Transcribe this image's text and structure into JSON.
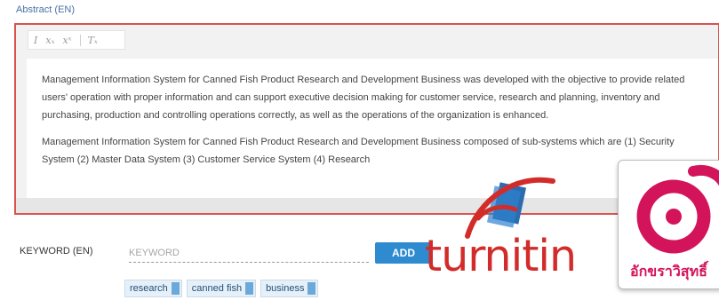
{
  "abstract": {
    "label": "Abstract (EN)",
    "toolbar": {
      "italic_label": "I",
      "subscript_label": "xₓ",
      "superscript_label": "xˣ",
      "clear_format_label": "Tₓ"
    },
    "paragraph_1": "Management Information System for Canned Fish Product Research and Development Business was developed with the objective to provide related users' operation with proper information and can support executive decision making for customer service, research and planning, inventory and purchasing, production and controlling operations correctly, as well as the operations of the organization is enhanced.",
    "paragraph_2": "Management Information System for Canned Fish Product Research and Development Business composed of sub-systems which are (1) Security System (2) Master Data System (3) Customer Service System (4) Research"
  },
  "keyword": {
    "label": "KEYWORD (EN)",
    "placeholder": "KEYWORD",
    "add_label": "ADD",
    "tags": [
      "research",
      "canned fish",
      "business"
    ]
  },
  "overlay_logos": {
    "turnitin_text": "turnitin",
    "thai_logo_text": "อักขราวิสุทธิ์"
  },
  "colors": {
    "editor_border": "#d9534f",
    "add_button": "#2e8bcf",
    "turnitin": "#d12c2a",
    "thai_logo": "#d4145a",
    "tag_remove": "#6aa9da"
  }
}
